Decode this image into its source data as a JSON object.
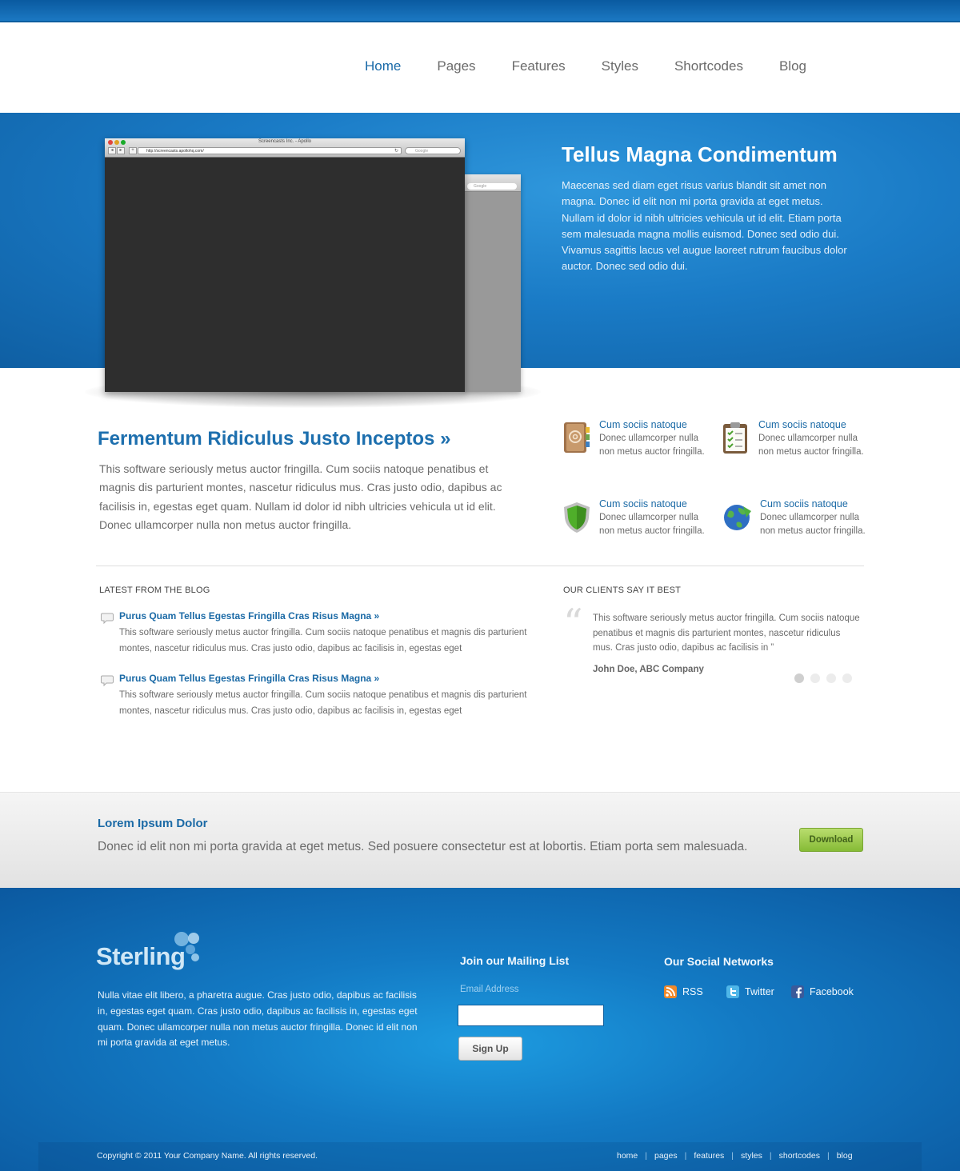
{
  "nav": {
    "items": [
      {
        "label": "Home",
        "active": true
      },
      {
        "label": "Pages"
      },
      {
        "label": "Features"
      },
      {
        "label": "Styles"
      },
      {
        "label": "Shortcodes"
      },
      {
        "label": "Blog"
      }
    ]
  },
  "hero": {
    "title": "Tellus Magna Condimentum",
    "text": "Maecenas sed diam eget risus varius blandit sit amet non magna. Donec id elit non mi porta gravida at eget metus. Nullam id dolor id nibh ultricies vehicula ut id elit. Etiam porta sem malesuada magna mollis euismod. Donec sed odio dui. Vivamus sagittis lacus vel augue laoreet rutrum faucibus dolor auctor. Donec sed odio dui.",
    "browser": {
      "window_title": "Screencasts Inc. - Apollo",
      "url": "http://screencasts.apollohq.com/",
      "search_placeholder": "Google",
      "back_search_placeholder": "Google"
    }
  },
  "feature": {
    "title": "Fermentum Ridiculus Justo Inceptos »",
    "text": "This software seriously metus auctor fringilla. Cum sociis natoque penatibus et magnis dis parturient montes, nascetur ridiculus mus. Cras justo odio, dapibus ac facilisis in, egestas eget quam. Nullam id dolor id nibh ultricies vehicula ut id elit. Donec ullamcorper nulla non metus auctor fringilla."
  },
  "features": [
    {
      "title": "Cum sociis natoque",
      "text": "Donec ullamcorper nulla non metus auctor fringilla.",
      "icon": "address-book-icon"
    },
    {
      "title": "Cum sociis natoque",
      "text": "Donec ullamcorper nulla non metus auctor fringilla.",
      "icon": "clipboard-icon"
    },
    {
      "title": "Cum sociis natoque",
      "text": "Donec ullamcorper nulla non metus auctor fringilla.",
      "icon": "shield-icon"
    },
    {
      "title": "Cum sociis natoque",
      "text": "Donec ullamcorper nulla non metus auctor fringilla.",
      "icon": "globe-icon"
    }
  ],
  "blog": {
    "heading": "LATEST FROM THE BLOG",
    "posts": [
      {
        "title": "Purus Quam Tellus Egestas Fringilla Cras Risus Magna »",
        "text": "This software seriously metus auctor fringilla. Cum sociis natoque penatibus et magnis dis parturient montes, nascetur ridiculus mus. Cras justo odio, dapibus ac facilisis in, egestas eget"
      },
      {
        "title": "Purus Quam Tellus Egestas Fringilla Cras Risus Magna »",
        "text": "This software seriously metus auctor fringilla. Cum sociis natoque penatibus et magnis dis parturient montes, nascetur ridiculus mus. Cras justo odio, dapibus ac facilisis in, egestas eget"
      }
    ]
  },
  "testimonial": {
    "heading": "OUR CLIENTS SAY IT BEST",
    "quote_mark": "“",
    "text": "This software seriously metus auctor fringilla. Cum sociis natoque penatibus et magnis dis parturient montes, nascetur ridiculus mus. Cras justo odio, dapibus ac facilisis in ”",
    "author": "John Doe, ABC Company",
    "pager_count": 4,
    "pager_active": 1
  },
  "callout": {
    "title": "Lorem Ipsum Dolor",
    "text": "Donec id elit non mi porta gravida at eget metus. Sed posuere consectetur est at lobortis. Etiam porta sem malesuada.",
    "button_label": "Download"
  },
  "footer": {
    "logo_text": "Sterling",
    "about": "Nulla vitae elit libero, a pharetra augue. Cras justo odio, dapibus ac facilisis in, egestas eget quam. Cras justo odio, dapibus ac facilisis in, egestas eget quam. Donec ullamcorper nulla non metus auctor fringilla. Donec id elit non mi porta gravida at eget metus.",
    "mailing": {
      "title": "Join our Mailing List",
      "label": "Email Address",
      "value": "",
      "button_label": "Sign Up"
    },
    "social": {
      "title": "Our Social Networks",
      "items": [
        {
          "label": "RSS",
          "icon": "rss-icon"
        },
        {
          "label": "Twitter",
          "icon": "twitter-icon"
        },
        {
          "label": "Facebook",
          "icon": "facebook-icon"
        }
      ]
    },
    "copyright": "Copyright © 2011 Your Company Name. All rights reserved.",
    "links": [
      "home",
      "pages",
      "features",
      "styles",
      "shortcodes",
      "blog"
    ],
    "link_separator": "|"
  },
  "colors": {
    "accent": "#1b6aa6",
    "hero_blue": "#1a7bc6",
    "download_green": "#86bb36"
  }
}
